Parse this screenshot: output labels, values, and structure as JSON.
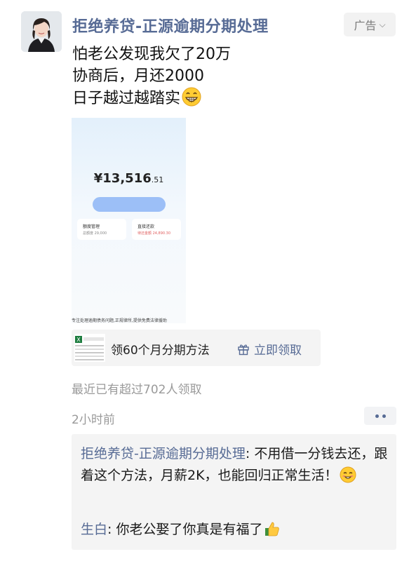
{
  "post": {
    "account_name": "拒绝养贷-正源逾期分期处理",
    "ad_label": "广告",
    "ad_chevron": "⌵",
    "lines": [
      "怕老公发现我欠了20万",
      "协商后，月还2000",
      "日子越过越踏实"
    ],
    "emoji": "grinning-face-icon"
  },
  "ad_image": {
    "currency": "¥",
    "amount_main": "13,516",
    "amount_cents": ".51",
    "card_left_title": "额度管理",
    "card_left_sub": "总额度 29,000",
    "card_right_title": "直接还款",
    "card_right_sub": "待还金额 24,890.30",
    "caption": "专注处理逾期债务问题,正规律所,提供免费法律援助"
  },
  "link_card": {
    "title": "领60个月分期方法",
    "action": "立即领取"
  },
  "stats": {
    "recent": "最近已有超过702人领取",
    "time": "2小时前"
  },
  "comments": [
    {
      "author": "拒绝养贷-正源逾期分期处理",
      "sep": ": ",
      "text": "不用借一分钱去还，跟着这个方法，月薪2K，也能回归正常生活！"
    },
    {
      "author": "生白",
      "sep": ": ",
      "text": "你老公娶了你真是有福了"
    }
  ],
  "colors": {
    "link": "#576b95",
    "muted": "#9a9a9a",
    "accent_blue": "#9cbff7"
  }
}
